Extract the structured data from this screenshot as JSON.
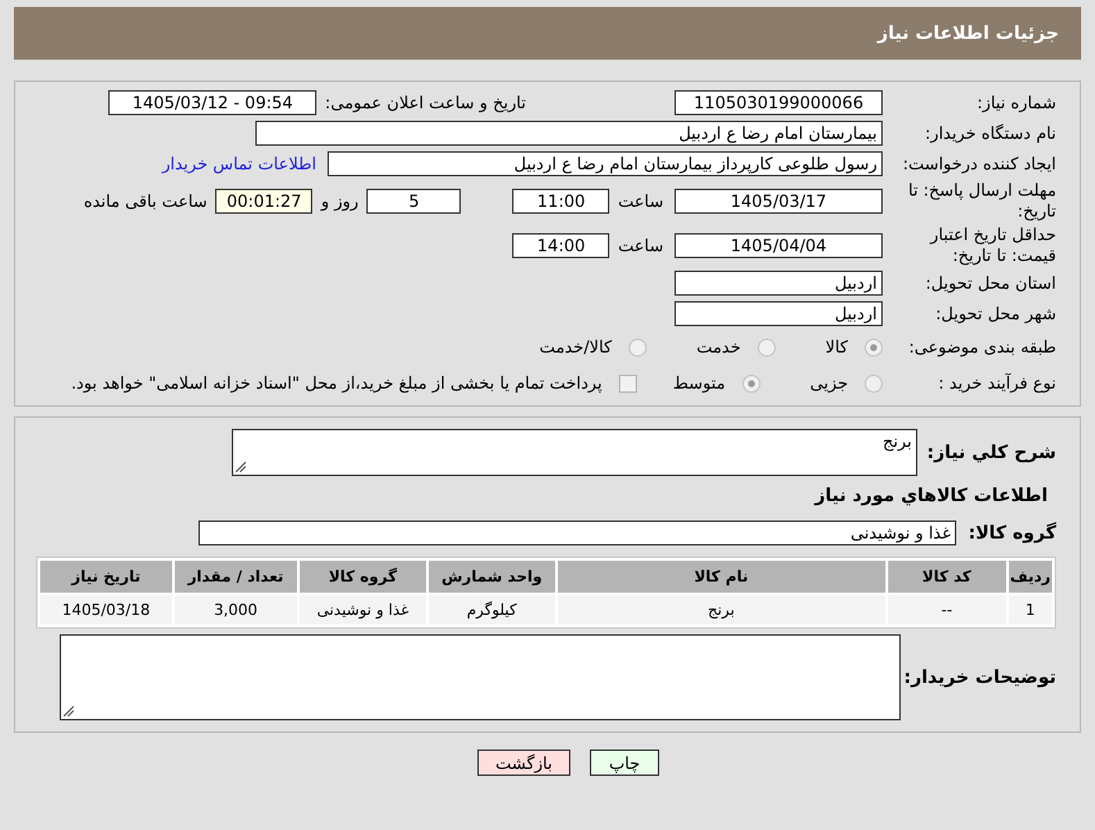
{
  "header": {
    "title": "جزئیات اطلاعات نیاز"
  },
  "need_number": {
    "label": "شماره نیاز:",
    "value": "1105030199000066"
  },
  "announce": {
    "label": "تاریخ و ساعت اعلان عمومی:",
    "value": "1405/03/12 - 09:54"
  },
  "buyer_org": {
    "label": "نام دستگاه خریدار:",
    "value": "بیمارستان امام رضا  ع  اردبیل"
  },
  "creator": {
    "label": "ایجاد کننده درخواست:",
    "value": "رسول طلوعی کارپرداز بیمارستان امام رضا  ع  اردبیل",
    "link": "اطلاعات تماس خریدار"
  },
  "deadline": {
    "label": "مهلت ارسال پاسخ: تا تاریخ:",
    "date": "1405/03/17",
    "time_label": "ساعت",
    "time": "11:00",
    "days": "5",
    "days_label": "روز و",
    "remaining": "00:01:27",
    "remaining_label": "ساعت باقی مانده"
  },
  "validity": {
    "label": "حداقل تاریخ اعتبار قیمت: تا تاریخ:",
    "date": "1405/04/04",
    "time_label": "ساعت",
    "time": "14:00"
  },
  "province": {
    "label": "استان محل تحویل:",
    "value": "اردبیل"
  },
  "city": {
    "label": "شهر محل تحویل:",
    "value": "اردبیل"
  },
  "category": {
    "label": "طبقه بندی موضوعی:",
    "options": [
      {
        "label": "کالا",
        "selected": true
      },
      {
        "label": "خدمت",
        "selected": false
      },
      {
        "label": "کالا/خدمت",
        "selected": false
      }
    ]
  },
  "process": {
    "label": "نوع فرآیند خرید :",
    "options": [
      {
        "label": "جزیی",
        "selected": false
      },
      {
        "label": "متوسط",
        "selected": true
      }
    ],
    "treasury": {
      "label": "پرداخت تمام یا بخشی از مبلغ خرید،از محل \"اسناد خزانه اسلامی\" خواهد بود.",
      "checked": false
    }
  },
  "description": {
    "label": "شرح کلي نياز:",
    "value": "برنج"
  },
  "goods_heading": "اطلاعات کالاهاي مورد نياز",
  "goods_group": {
    "label": "گروه کالا:",
    "value": "غذا و نوشیدنی"
  },
  "table": {
    "columns": [
      "ردیف",
      "کد کالا",
      "نام کالا",
      "واحد شمارش",
      "گروه کالا",
      "تعداد / مقدار",
      "تاریخ نیاز"
    ],
    "rows": [
      [
        "1",
        "--",
        "برنج",
        "کیلوگرم",
        "غذا و نوشیدنی",
        "3,000",
        "1405/03/18"
      ]
    ]
  },
  "buyer_notes": {
    "label": "توضیحات خریدار:"
  },
  "buttons": [
    {
      "label": "چاپ",
      "kind": "print"
    },
    {
      "label": "بازگشت",
      "kind": "back"
    }
  ]
}
